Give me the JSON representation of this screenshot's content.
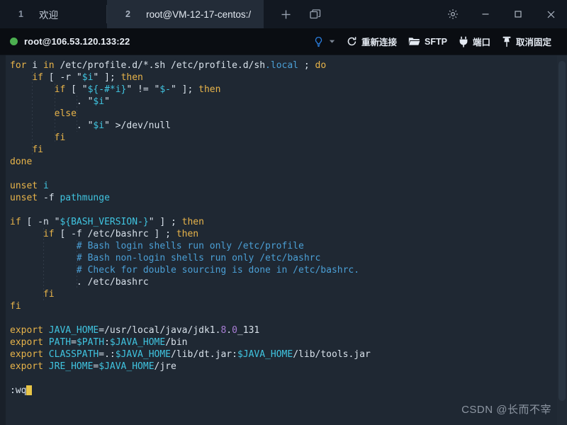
{
  "window": {
    "tabs": [
      {
        "num": "1",
        "label": "欢迎",
        "active": false
      },
      {
        "num": "2",
        "label": "root@VM-12-17-centos:/",
        "active": true
      }
    ],
    "new_tab_label": "+",
    "tab_manager_icon": "windows-icon",
    "settings_icon": "gear-icon",
    "minimize_label": "—",
    "maximize_label": "□",
    "close_label": "×"
  },
  "toolbar": {
    "connection": "root@106.53.120.133:22",
    "status_color": "#4caf50",
    "hint_icon": "lightbulb-icon",
    "reconnect_label": "重新连接",
    "sftp_label": "SFTP",
    "port_label": "端口",
    "unpin_label": "取消固定"
  },
  "terminal": {
    "cursor_text": ":wq",
    "lines": [
      {
        "i": 0,
        "segs": [
          {
            "t": "for",
            "c": "kw"
          },
          {
            "t": " i ",
            "c": "pln"
          },
          {
            "t": "in",
            "c": "kw"
          },
          {
            "t": " /etc/profile.d/*.sh /etc/profile.d/sh",
            "c": "pln"
          },
          {
            "t": ".local",
            "c": "blu"
          },
          {
            "t": " ; ",
            "c": "pln"
          },
          {
            "t": "do",
            "c": "kw"
          }
        ]
      },
      {
        "i": 1,
        "segs": [
          {
            "t": "    ",
            "c": "pln"
          },
          {
            "t": "if",
            "c": "kw"
          },
          {
            "t": " [ -r \"",
            "c": "pln"
          },
          {
            "t": "$i",
            "c": "var"
          },
          {
            "t": "\" ]; ",
            "c": "pln"
          },
          {
            "t": "then",
            "c": "kw"
          }
        ]
      },
      {
        "i": 2,
        "segs": [
          {
            "t": "        ",
            "c": "pln"
          },
          {
            "t": "if",
            "c": "kw"
          },
          {
            "t": " [ \"",
            "c": "pln"
          },
          {
            "t": "${-#*i}",
            "c": "var"
          },
          {
            "t": "\" != \"",
            "c": "pln"
          },
          {
            "t": "$-",
            "c": "var"
          },
          {
            "t": "\" ]; ",
            "c": "pln"
          },
          {
            "t": "then",
            "c": "kw"
          }
        ]
      },
      {
        "i": 3,
        "segs": [
          {
            "t": "            . \"",
            "c": "pln"
          },
          {
            "t": "$i",
            "c": "var"
          },
          {
            "t": "\"",
            "c": "pln"
          }
        ]
      },
      {
        "i": 4,
        "segs": [
          {
            "t": "        ",
            "c": "pln"
          },
          {
            "t": "else",
            "c": "kw"
          }
        ]
      },
      {
        "i": 5,
        "segs": [
          {
            "t": "            . \"",
            "c": "pln"
          },
          {
            "t": "$i",
            "c": "var"
          },
          {
            "t": "\" >/dev/null",
            "c": "pln"
          }
        ]
      },
      {
        "i": 6,
        "segs": [
          {
            "t": "        ",
            "c": "pln"
          },
          {
            "t": "fi",
            "c": "kw"
          }
        ]
      },
      {
        "i": 7,
        "segs": [
          {
            "t": "    ",
            "c": "pln"
          },
          {
            "t": "fi",
            "c": "kw"
          }
        ]
      },
      {
        "i": 8,
        "segs": [
          {
            "t": "done",
            "c": "kw"
          }
        ]
      },
      {
        "i": 9,
        "segs": []
      },
      {
        "i": 10,
        "segs": [
          {
            "t": "unset",
            "c": "kw"
          },
          {
            "t": " ",
            "c": "pln"
          },
          {
            "t": "i",
            "c": "var"
          }
        ]
      },
      {
        "i": 11,
        "segs": [
          {
            "t": "unset",
            "c": "kw"
          },
          {
            "t": " -f ",
            "c": "pln"
          },
          {
            "t": "pathmunge",
            "c": "var"
          }
        ]
      },
      {
        "i": 12,
        "segs": []
      },
      {
        "i": 13,
        "segs": [
          {
            "t": "if",
            "c": "kw"
          },
          {
            "t": " [ -n \"",
            "c": "pln"
          },
          {
            "t": "${BASH_VERSION-}",
            "c": "var"
          },
          {
            "t": "\" ] ; ",
            "c": "pln"
          },
          {
            "t": "then",
            "c": "kw"
          }
        ]
      },
      {
        "i": 14,
        "segs": [
          {
            "t": "      ",
            "c": "pln"
          },
          {
            "t": "if",
            "c": "kw"
          },
          {
            "t": " [ -f /etc/bashrc ] ; ",
            "c": "pln"
          },
          {
            "t": "then",
            "c": "kw"
          }
        ]
      },
      {
        "i": 15,
        "segs": [
          {
            "t": "            # Bash login shells run only /etc/profile",
            "c": "cmt"
          }
        ]
      },
      {
        "i": 16,
        "segs": [
          {
            "t": "            # Bash non-login shells run only /etc/bashrc",
            "c": "cmt"
          }
        ]
      },
      {
        "i": 17,
        "segs": [
          {
            "t": "            # Check for double sourcing is done in /etc/bashrc.",
            "c": "cmt"
          }
        ]
      },
      {
        "i": 18,
        "segs": [
          {
            "t": "            . /etc/bashrc",
            "c": "pln"
          }
        ]
      },
      {
        "i": 19,
        "segs": [
          {
            "t": "      ",
            "c": "pln"
          },
          {
            "t": "fi",
            "c": "kw"
          }
        ]
      },
      {
        "i": 20,
        "segs": [
          {
            "t": "fi",
            "c": "kw"
          }
        ]
      },
      {
        "i": 21,
        "segs": []
      },
      {
        "i": 22,
        "segs": [
          {
            "t": "export",
            "c": "kw"
          },
          {
            "t": " ",
            "c": "pln"
          },
          {
            "t": "JAVA_HOME",
            "c": "var"
          },
          {
            "t": "=/usr/local/java/jdk1.",
            "c": "pln"
          },
          {
            "t": "8",
            "c": "num"
          },
          {
            "t": ".",
            "c": "pln"
          },
          {
            "t": "0",
            "c": "num"
          },
          {
            "t": "_131",
            "c": "pln"
          }
        ]
      },
      {
        "i": 23,
        "segs": [
          {
            "t": "export",
            "c": "kw"
          },
          {
            "t": " ",
            "c": "pln"
          },
          {
            "t": "PATH",
            "c": "var"
          },
          {
            "t": "=",
            "c": "pln"
          },
          {
            "t": "$PATH",
            "c": "var"
          },
          {
            "t": ":",
            "c": "pln"
          },
          {
            "t": "$JAVA_HOME",
            "c": "var"
          },
          {
            "t": "/bin",
            "c": "pln"
          }
        ]
      },
      {
        "i": 24,
        "segs": [
          {
            "t": "export",
            "c": "kw"
          },
          {
            "t": " ",
            "c": "pln"
          },
          {
            "t": "CLASSPATH",
            "c": "var"
          },
          {
            "t": "=.:",
            "c": "pln"
          },
          {
            "t": "$JAVA_HOME",
            "c": "var"
          },
          {
            "t": "/lib/dt.jar:",
            "c": "pln"
          },
          {
            "t": "$JAVA_HOME",
            "c": "var"
          },
          {
            "t": "/lib/tools.jar",
            "c": "pln"
          }
        ]
      },
      {
        "i": 25,
        "segs": [
          {
            "t": "export",
            "c": "kw"
          },
          {
            "t": " ",
            "c": "pln"
          },
          {
            "t": "JRE_HOME",
            "c": "var"
          },
          {
            "t": "=",
            "c": "pln"
          },
          {
            "t": "$JAVA_HOME",
            "c": "var"
          },
          {
            "t": "/jre",
            "c": "pln"
          }
        ]
      },
      {
        "i": 26,
        "segs": []
      },
      {
        "i": 27,
        "segs": [
          {
            "t": ":wq",
            "c": "pln"
          },
          {
            "t": "__CURSOR__",
            "c": "cursor"
          }
        ]
      }
    ]
  },
  "watermark": "CSDN @长而不宰"
}
